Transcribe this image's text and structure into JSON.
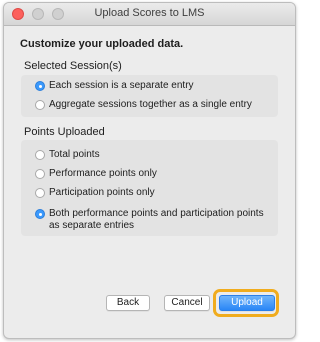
{
  "window": {
    "title": "Upload Scores to LMS"
  },
  "heading": "Customize your uploaded data.",
  "sessions": {
    "label": "Selected Session(s)",
    "options": [
      {
        "label": "Each session is a separate entry",
        "selected": true
      },
      {
        "label": "Aggregate sessions together as a single entry",
        "selected": false
      }
    ]
  },
  "points": {
    "label": "Points Uploaded",
    "options": [
      {
        "label": "Total points",
        "selected": false
      },
      {
        "label": "Performance points only",
        "selected": false
      },
      {
        "label": "Participation points only",
        "selected": false
      },
      {
        "label": "Both performance points and participation points as separate entries",
        "selected": true
      }
    ]
  },
  "buttons": {
    "back": "Back",
    "cancel": "Cancel",
    "upload": "Upload"
  },
  "colors": {
    "accent": "#3b99fc",
    "highlight": "#f0ac1e",
    "close": "#fc605c"
  }
}
